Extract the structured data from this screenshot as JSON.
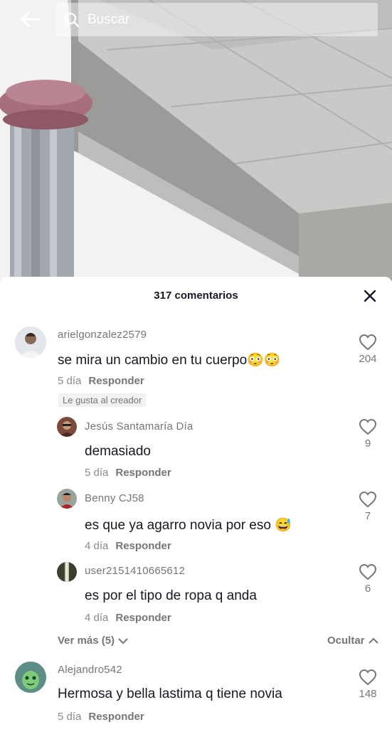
{
  "search": {
    "placeholder": "Buscar"
  },
  "comments_header": {
    "title": "317 comentarios"
  },
  "comments": [
    {
      "username": "arielgonzalez2579",
      "text": "se mira un cambio en tu cuerpo😳😳",
      "time": "5 día",
      "reply_label": "Responder",
      "likes": "204",
      "badge": "Le gusta al creador",
      "replies": [
        {
          "username": "Jesús Santamaría Día",
          "text": "demasiado",
          "time": "5 día",
          "reply_label": "Responder",
          "likes": "9"
        },
        {
          "username": "Benny CJ58",
          "text": "es que ya agarro novia por eso 😅",
          "time": "4 día",
          "reply_label": "Responder",
          "likes": "7"
        },
        {
          "username": "user2151410665612",
          "text": "es por el tipo de ropa q anda",
          "time": "4 día",
          "reply_label": "Responder",
          "likes": "6"
        }
      ],
      "more_replies": "Ver más (5)",
      "hide_label": "Ocultar"
    },
    {
      "username": "Alejandro542",
      "text": "Hermosa y bella lastima q tiene novia",
      "time": "5 día",
      "reply_label": "Responder",
      "likes": "148"
    }
  ],
  "colors": {
    "text": "#161823",
    "secondary": "#75767a",
    "badge_bg": "#f1f1f2"
  },
  "icons": [
    "back-arrow-icon",
    "search-icon",
    "close-icon",
    "heart-outline-icon",
    "chevron-down-icon",
    "chevron-up-icon"
  ]
}
